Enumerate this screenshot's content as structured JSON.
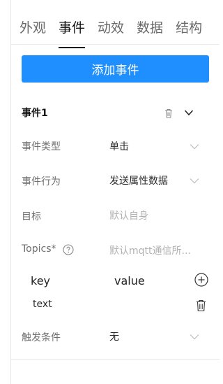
{
  "tabs": [
    {
      "label": "外观",
      "active": false
    },
    {
      "label": "事件",
      "active": true
    },
    {
      "label": "动效",
      "active": false
    },
    {
      "label": "数据",
      "active": false
    },
    {
      "label": "结构",
      "active": false
    }
  ],
  "add_event_button": "添加事件",
  "event": {
    "title": "事件1",
    "rows": {
      "type": {
        "label": "事件类型",
        "value": "单击"
      },
      "action": {
        "label": "事件行为",
        "value": "发送属性数据"
      },
      "target": {
        "label": "目标",
        "placeholder": "默认自身"
      },
      "topics": {
        "label": "Topics*",
        "placeholder": "默认mqtt通信所..."
      },
      "trigger": {
        "label": "触发条件",
        "value": "无"
      }
    },
    "kv": {
      "key_header": "key",
      "value_header": "value",
      "items": [
        {
          "key": "text"
        }
      ]
    }
  },
  "colors": {
    "accent": "#1f8fff"
  },
  "icons": {
    "delete": "trash-icon",
    "collapse": "chevron-down-icon",
    "help": "question-circle-icon",
    "add": "plus-circle-icon"
  }
}
